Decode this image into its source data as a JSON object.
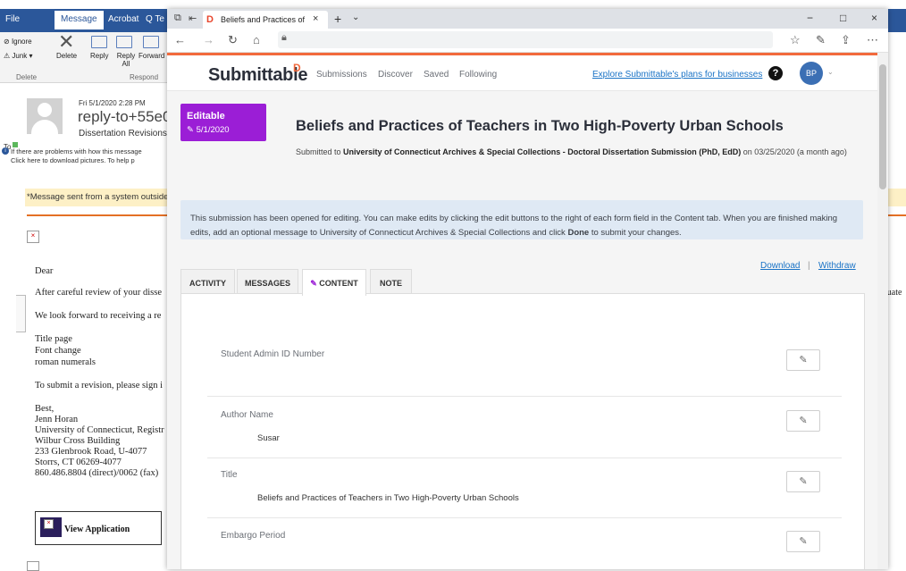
{
  "outlook": {
    "tabs": [
      "File",
      "Message",
      "Acrobat",
      "Q Te"
    ],
    "ribbon": {
      "ignore": "Ignore",
      "junk": "Junk",
      "delete": "Delete",
      "reply": "Reply",
      "reply_all": "Reply All",
      "forward": "Forward",
      "group_delete": "Delete",
      "group_respond": "Respond"
    },
    "header": {
      "date": "Fri 5/1/2020 2:28 PM",
      "sender": "reply-to+55e05c",
      "subject": "Dissertation Revisions",
      "to": "To"
    },
    "info_line1": "If there are problems with how this message",
    "info_line2": "Click here to download pictures. To help p",
    "banner": "*Message sent from a system outside o",
    "body_lines": [
      "Dear",
      "After careful review of your disse",
      "We look forward to receiving a re",
      "Title page",
      "Font change",
      "roman numerals",
      "To submit a revision, please sign i",
      "Best,",
      "Jenn Horan",
      "University of Connecticut, Registr",
      "Wilbur Cross Building",
      "233 Glenbrook Road, U-4077",
      "Storrs, CT 06269-4077",
      "860.486.8804 (direct)/0062 (fax)"
    ],
    "right_text": "luate",
    "view_app": "View Application"
  },
  "browser": {
    "tab_title": "Beliefs and Practices of",
    "favicon": "D",
    "close": "×",
    "new_tab": "+",
    "dropdown": "⌄",
    "min": "−",
    "max": "□",
    "close_window": "×"
  },
  "submittable": {
    "logo": "Submittable",
    "nav": [
      "Submissions",
      "Discover",
      "Saved",
      "Following"
    ],
    "explore": "Explore Submittable's plans for businesses",
    "help": "?",
    "avatar": "BP",
    "editable_label": "Editable",
    "editable_date": "5/1/2020",
    "title": "Beliefs and Practices of Teachers in Two High-Poverty Urban Schools",
    "submitted_prefix": "Submitted to ",
    "submitted_org": "University of Connecticut Archives & Special Collections - Doctoral Dissertation Submission (PhD, EdD)",
    "submitted_suffix": " on 03/25/2020 (a month ago)",
    "notice": {
      "part1": "This submission has been opened for editing. You can make edits by clicking the edit buttons to the right of each form field in the Content tab. When you are finished making edits, add an optional message to University of Connecticut Archives & Special Collections and click ",
      "done": "Done",
      "part2": " to submit your changes."
    },
    "download": "Download",
    "separator": "|",
    "withdraw": "Withdraw",
    "tabs": [
      "ACTIVITY",
      "MESSAGES",
      "CONTENT",
      "NOTE"
    ],
    "fields": [
      {
        "label": "Student Admin ID Number",
        "value": ""
      },
      {
        "label": "Author Name",
        "value": "Susar"
      },
      {
        "label": "Title",
        "value": "Beliefs and Practices of Teachers in Two High-Poverty Urban Schools"
      },
      {
        "label": "Embargo Period",
        "value": ""
      }
    ]
  },
  "colors": {
    "outlook_blue": "#2b579a",
    "submittable_orange": "#f26a3d",
    "editable_purple": "#9b1ed6",
    "link_blue": "#1a73c6",
    "notice_bg": "#dfe9f4"
  }
}
